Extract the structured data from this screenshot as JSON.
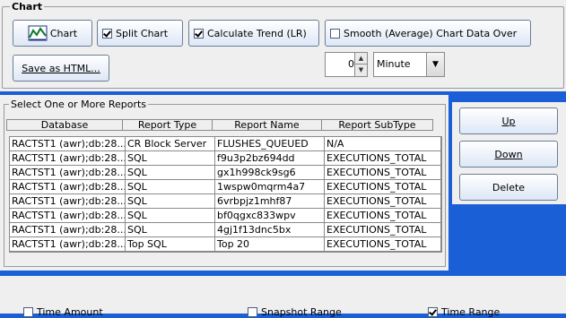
{
  "chart_group": {
    "title": "Chart",
    "chart_button": "Chart",
    "split_chart": {
      "label": "Split Chart",
      "checked": true
    },
    "calc_trend": {
      "label": "Calculate Trend (LR)",
      "checked": true
    },
    "smooth": {
      "label": "Smooth (Average) Chart Data Over",
      "checked": false
    },
    "save_html": "Save as HTML...",
    "interval_value": "0",
    "interval_unit": "Minute"
  },
  "reports": {
    "title": "Select One or More Reports",
    "columns": [
      "Database",
      "Report Type",
      "Report Name",
      "Report SubType"
    ],
    "rows": [
      [
        "RACTST1 (awr);db:28...",
        "CR Block Server",
        "FLUSHES_QUEUED",
        "N/A"
      ],
      [
        "RACTST1 (awr);db:28...",
        "SQL",
        "f9u3p2bz694dd",
        "EXECUTIONS_TOTAL"
      ],
      [
        "RACTST1 (awr);db:28...",
        "SQL",
        "gx1h998ck9sg6",
        "EXECUTIONS_TOTAL"
      ],
      [
        "RACTST1 (awr);db:28...",
        "SQL",
        "1wspw0mqrm4a7",
        "EXECUTIONS_TOTAL"
      ],
      [
        "RACTST1 (awr);db:28...",
        "SQL",
        "6vrbpjz1mhf87",
        "EXECUTIONS_TOTAL"
      ],
      [
        "RACTST1 (awr);db:28...",
        "SQL",
        "bf0qgxc833wpv",
        "EXECUTIONS_TOTAL"
      ],
      [
        "RACTST1 (awr);db:28...",
        "SQL",
        "4gj1f13dnc5bx",
        "EXECUTIONS_TOTAL"
      ],
      [
        "RACTST1 (awr);db:28...",
        "Top SQL",
        "Top 20",
        "EXECUTIONS_TOTAL"
      ]
    ]
  },
  "side_buttons": {
    "up": "Up",
    "down": "Down",
    "delete": "Delete"
  },
  "bottom_options": {
    "time_amount": {
      "label": "Time Amount",
      "checked": false
    },
    "snapshot_range": {
      "label": "Snapshot Range",
      "checked": false
    },
    "time_range": {
      "label": "Time Range",
      "checked": true
    }
  },
  "colors": {
    "background_blue": "#1a5fd6",
    "panel": "#efefef"
  }
}
